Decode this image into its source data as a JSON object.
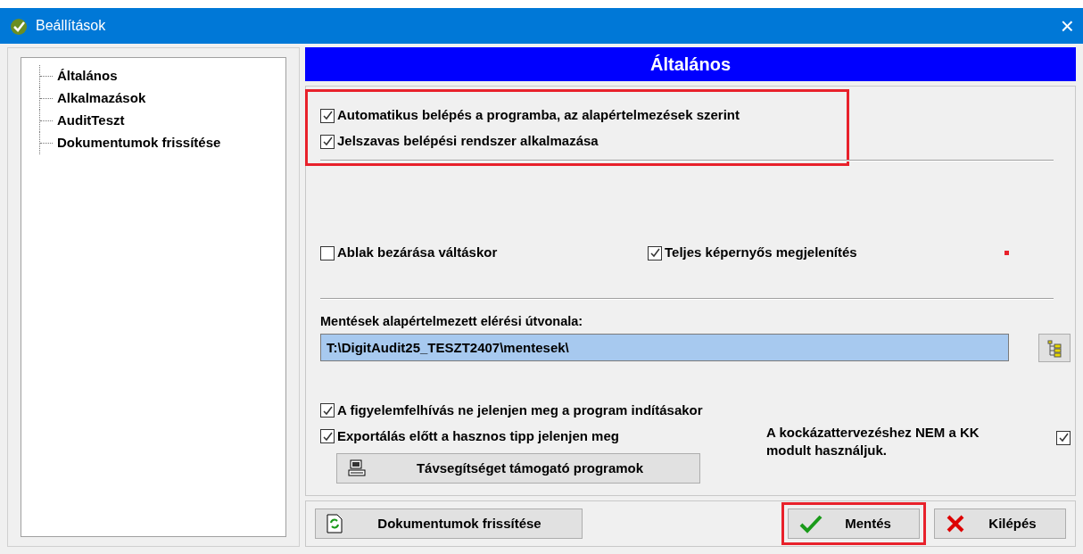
{
  "window": {
    "title": "Beállítások",
    "close": "×"
  },
  "tree": {
    "items": [
      {
        "label": "Általános",
        "selected": false
      },
      {
        "label": "Alkalmazások",
        "selected": false
      },
      {
        "label": "AuditTeszt",
        "selected": false
      },
      {
        "label": "Dokumentumok frissítése",
        "selected": false
      }
    ]
  },
  "header": "Általános",
  "login_group": {
    "highlighted": true,
    "options": [
      {
        "label": "Automatikus belépés a programba, az alapértelmezések szerint",
        "checked": true
      },
      {
        "label": "Jelszavas belépési rendszer alkalmazása",
        "checked": true
      }
    ]
  },
  "display_options": [
    {
      "label": "Ablak bezárása váltáskor",
      "checked": false
    },
    {
      "label": "Teljes képernyős megjelenítés",
      "checked": true
    }
  ],
  "red_marker": true,
  "backup_path": {
    "label": "Mentések alapértelmezett elérési útvonala:",
    "value": "T:\\DigitAudit25_TESZT2407\\mentesek\\"
  },
  "startup_options": [
    {
      "label": "A figyelemfelhívás ne jelenjen meg a program indításakor",
      "checked": true
    },
    {
      "label": "Exportálás előtt a hasznos tipp jelenjen meg",
      "checked": true
    }
  ],
  "risk_option": {
    "label": "A kockázattervezéshez NEM a KK modult használjuk.",
    "checked": true
  },
  "remote_button": "Távsegítséget támogató programok",
  "buttons": [
    {
      "kind": "refresh",
      "label": "Dokumentumok frissítése",
      "highlighted": false
    },
    {
      "kind": "save",
      "label": "Mentés",
      "highlighted": true
    },
    {
      "kind": "exit",
      "label": "Kilépés",
      "highlighted": false
    }
  ]
}
